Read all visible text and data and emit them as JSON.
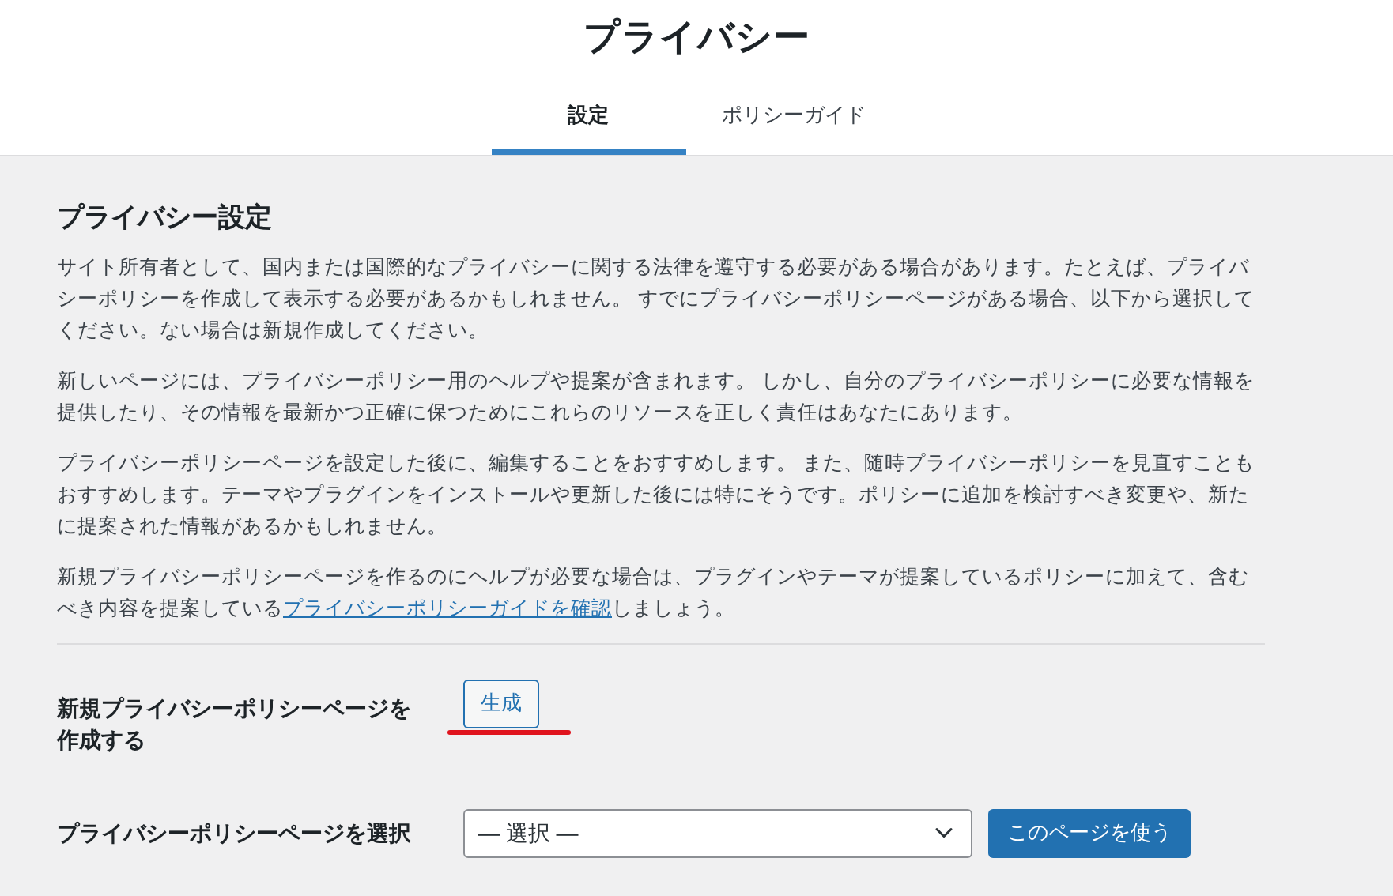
{
  "header": {
    "title": "プライバシー"
  },
  "tabs": [
    {
      "label": "設定",
      "selected": true
    },
    {
      "label": "ポリシーガイド",
      "selected": false
    }
  ],
  "section": {
    "heading": "プライバシー設定",
    "paragraphs": [
      "サイト所有者として、国内または国際的なプライバシーに関する法律を遵守する必要がある場合があります。たとえば、プライバシーポリシーを作成して表示する必要があるかもしれません。 すでにプライバシーポリシーページがある場合、以下から選択してください。ない場合は新規作成してください。",
      "新しいページには、プライバシーポリシー用のヘルプや提案が含まれます。 しかし、自分のプライバシーポリシーに必要な情報を提供したり、その情報を最新かつ正確に保つためにこれらのリソースを正しく責任はあなたにあります。",
      "プライバシーポリシーページを設定した後に、編集することをおすすめします。 また、随時プライバシーポリシーを見直すこともおすすめします。テーマやプラグインをインストールや更新した後には特にそうです。ポリシーに追加を検討すべき変更や、新たに提案された情報があるかもしれません。"
    ],
    "help": {
      "before": "新規プライバシーポリシーページを作るのにヘルプが必要な場合は、プラグインやテーマが提案しているポリシーに加えて、含むべき内容を提案している",
      "link": "プライバシーポリシーガイドを確認",
      "after": "しましょう。"
    }
  },
  "create_row": {
    "label": "新規プライバシーポリシーページを作成する",
    "button": "生成",
    "underlined": true
  },
  "select_row": {
    "label": "プライバシーポリシーページを選択",
    "select_value": "— 選択 —",
    "button": "このページを使う"
  }
}
